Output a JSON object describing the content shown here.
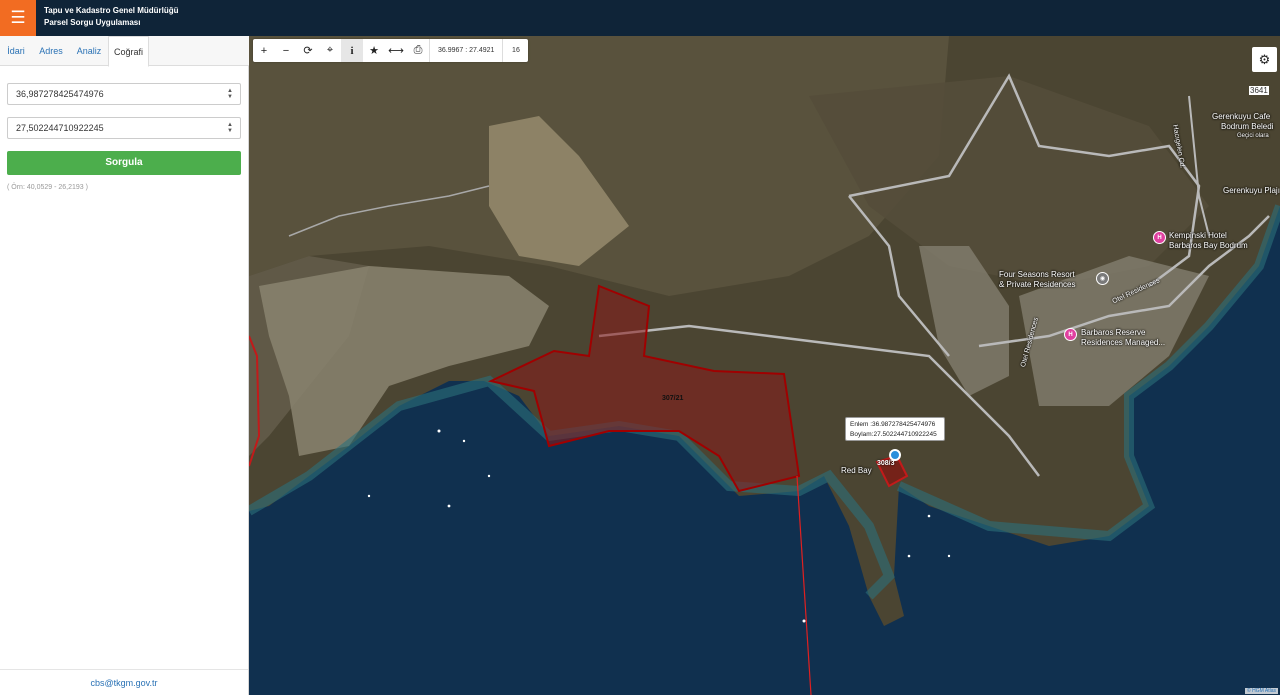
{
  "header": {
    "menu_icon": "hamburger-icon",
    "title_line1": "Tapu ve Kadastro Genel Müdürlüğü",
    "title_line2": "Parsel Sorgu Uygulaması"
  },
  "sidebar": {
    "tabs": [
      {
        "label": "İdari"
      },
      {
        "label": "Adres"
      },
      {
        "label": "Analiz"
      },
      {
        "label": "Coğrafi"
      }
    ],
    "active_tab": "Coğrafi",
    "lat_value": "36,987278425474976",
    "lon_value": "27,502244710922245",
    "query_button": "Sorgula",
    "example_text": "( Örn: 40,0529 - 26,2193 )",
    "footer_email": "cbs@tkgm.gov.tr"
  },
  "toolbar": {
    "coordinates": "36.9967 : 27.4921",
    "zoom": "16"
  },
  "map": {
    "labels": {
      "gerenkuyu_cafe": "Gerenkuyu Cafe",
      "bodrum_belediye": "Bodrum Beledi",
      "gecici": "Geçici olara",
      "gerenkuyu_plaj": "Gerenkuyu Plajı",
      "road_num": "3641",
      "hacigelen": "Hacıgelen Cd.",
      "kempinski1": "Kempinski Hotel",
      "kempinski2": "Barbaros Bay Bodrum",
      "fourseasons1": "Four Seasons Resort",
      "fourseasons2": "& Private Residences",
      "otel_res": "Otel Residences",
      "barbaros1": "Barbaros Reserve",
      "barbaros2": "Residences Managed...",
      "otel_res_v": "Otel Residences",
      "red_bay": "Red Bay"
    },
    "parcels": {
      "main": "307/21",
      "small": "308/3"
    },
    "popup": {
      "line1": "Enlem :36.987278425474976",
      "line2": "Boylam:27.502244710922245"
    },
    "attribution": "© HGM Atlas"
  },
  "colors": {
    "header_bg": "#0f2438",
    "menu_accent": "#f26c22",
    "query_green": "#4cae4c",
    "parcel_outline": "#a00000",
    "poi_pink": "#e040a0"
  }
}
